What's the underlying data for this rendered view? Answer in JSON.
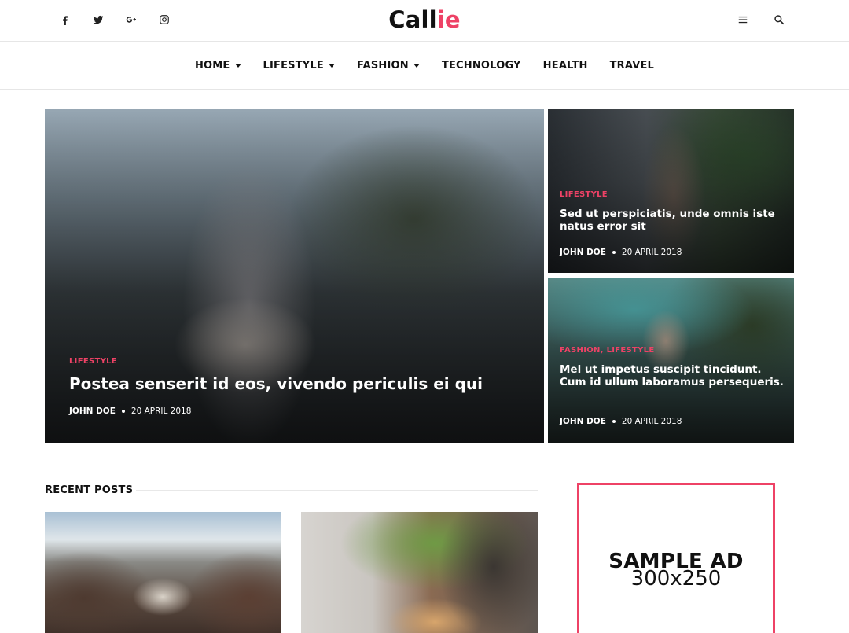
{
  "header": {
    "logo_main": "Call",
    "logo_accent": "ie",
    "social": [
      {
        "label": "f",
        "icon": "facebook-icon"
      },
      {
        "label": "twitter",
        "icon": "twitter-icon"
      },
      {
        "label": "G+",
        "icon": "google-plus-icon"
      },
      {
        "label": "instagram",
        "icon": "instagram-icon"
      }
    ],
    "tools": [
      {
        "icon": "menu-icon"
      },
      {
        "icon": "search-icon"
      }
    ]
  },
  "nav": {
    "items": [
      {
        "label": "HOME",
        "dropdown": true
      },
      {
        "label": "LIFESTYLE",
        "dropdown": true
      },
      {
        "label": "FASHION",
        "dropdown": true
      },
      {
        "label": "TECHNOLOGY",
        "dropdown": false
      },
      {
        "label": "HEALTH",
        "dropdown": false
      },
      {
        "label": "TRAVEL",
        "dropdown": false
      }
    ]
  },
  "hero": {
    "main": {
      "category": "LIFESTYLE",
      "title": "Postea senserit id eos, vivendo periculis ei qui",
      "author": "JOHN DOE",
      "date": "20 APRIL 2018"
    },
    "side_top": {
      "category": "LIFESTYLE",
      "title": "Sed ut perspiciatis, unde omnis iste natus error sit",
      "author": "JOHN DOE",
      "date": "20 APRIL 2018"
    },
    "side_bottom": {
      "category": "FASHION, LIFESTYLE",
      "title": "Mel ut impetus suscipit tincidunt. Cum id ullum laboramus persequeris.",
      "author": "JOHN DOE",
      "date": "20 APRIL 2018"
    }
  },
  "recent": {
    "heading": "RECENT POSTS"
  },
  "ad": {
    "title": "SAMPLE AD",
    "size": "300x250"
  },
  "colors": {
    "accent": "#ee4266",
    "text": "#111111",
    "border": "#e6e6e6"
  }
}
